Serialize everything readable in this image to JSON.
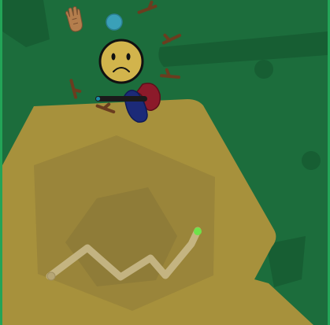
{
  "game": {
    "colors": {
      "background": "#1c6d3c",
      "background_dark": "#175e33",
      "border": "#23a457",
      "sand": "#a7913c",
      "sand_mid": "#9a853a",
      "sand_inner": "#8f7c38",
      "trail": "#c9b98a",
      "trail_head": "#6fe24a",
      "player_face": "#d2b44c",
      "player_outline": "#111111",
      "stick": "#6a3d1f",
      "bubble": "#3aa0b8",
      "hand_item": "#b47e4d",
      "health_bar_bg": "#1a1a1a",
      "health_bar_fill": "#1a8aa8",
      "backpack_red": "#8c1a2a",
      "backpack_blue": "#1c2a78"
    },
    "player": {
      "expression": "sad",
      "health": 0.08
    },
    "items": {
      "sticks": [
        "stick",
        "stick",
        "stick",
        "stick",
        "stick",
        "stick"
      ],
      "bubble": "water-droplet",
      "glove": "hand-print-icon"
    }
  }
}
